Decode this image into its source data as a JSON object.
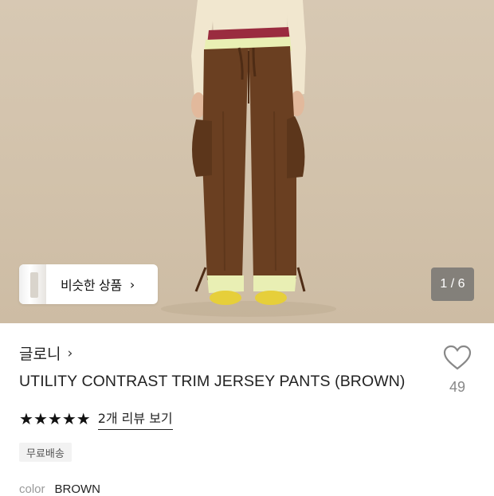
{
  "hero": {
    "similar_label": "비슷한 상품",
    "pager_current": "1",
    "pager_sep": " / ",
    "pager_total": "6"
  },
  "product": {
    "brand": "글로니",
    "title": "UTILITY CONTRAST TRIM JERSEY PANTS (BROWN)",
    "wish_count": "49",
    "rating_stars": 5,
    "review_link": "2개 리뷰 보기",
    "shipping_badge": "무료배송",
    "color_label": "color",
    "color_value": "BROWN"
  },
  "colors": {
    "pants": "#6a3f21",
    "top": "#f1e7cf",
    "trim": "#e9efb4",
    "waistband": "#9a2c3f",
    "shoes": "#e6cf3a",
    "backdrop": "#d3c4ad"
  }
}
